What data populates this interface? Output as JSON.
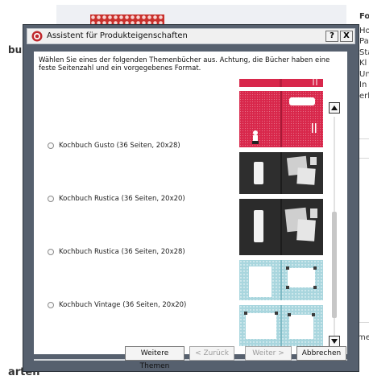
{
  "background": {
    "left_heading": "bu",
    "bottom_heading": "arten",
    "right_column": [
      "Fo",
      "Ho",
      "Pa",
      "Sta",
      "Kl",
      "Un",
      "In",
      "erl"
    ],
    "right_bottom": "me"
  },
  "dialog": {
    "title": "Assistent für Produkteigenschaften",
    "help_label": "?",
    "close_label": "X",
    "intro": "Wählen Sie eines der folgenden Themenbücher aus. Achtung, die Bücher haben eine feste Seitenzahl und ein vorgegebenes Format.",
    "options": [
      {
        "label": "Kochbuch Gusto (36 Seiten, 20x28)",
        "selected": false
      },
      {
        "label": "Kochbuch Rustica (36 Seiten, 20x20)",
        "selected": false
      },
      {
        "label": "Kochbuch Rustica (36 Seiten, 20x28)",
        "selected": false
      },
      {
        "label": "Kochbuch Vintage (36 Seiten, 20x20)",
        "selected": false
      }
    ],
    "buttons": {
      "more_themes": "Weitere Themen",
      "back_label": "< Zurück",
      "next_label": "Weiter >",
      "cancel": "Abbrechen"
    },
    "colors": {
      "gusto_red": "#d8274b",
      "rustica_dark": "#2e2e2e",
      "vintage_blue": "#a9d6de"
    }
  }
}
